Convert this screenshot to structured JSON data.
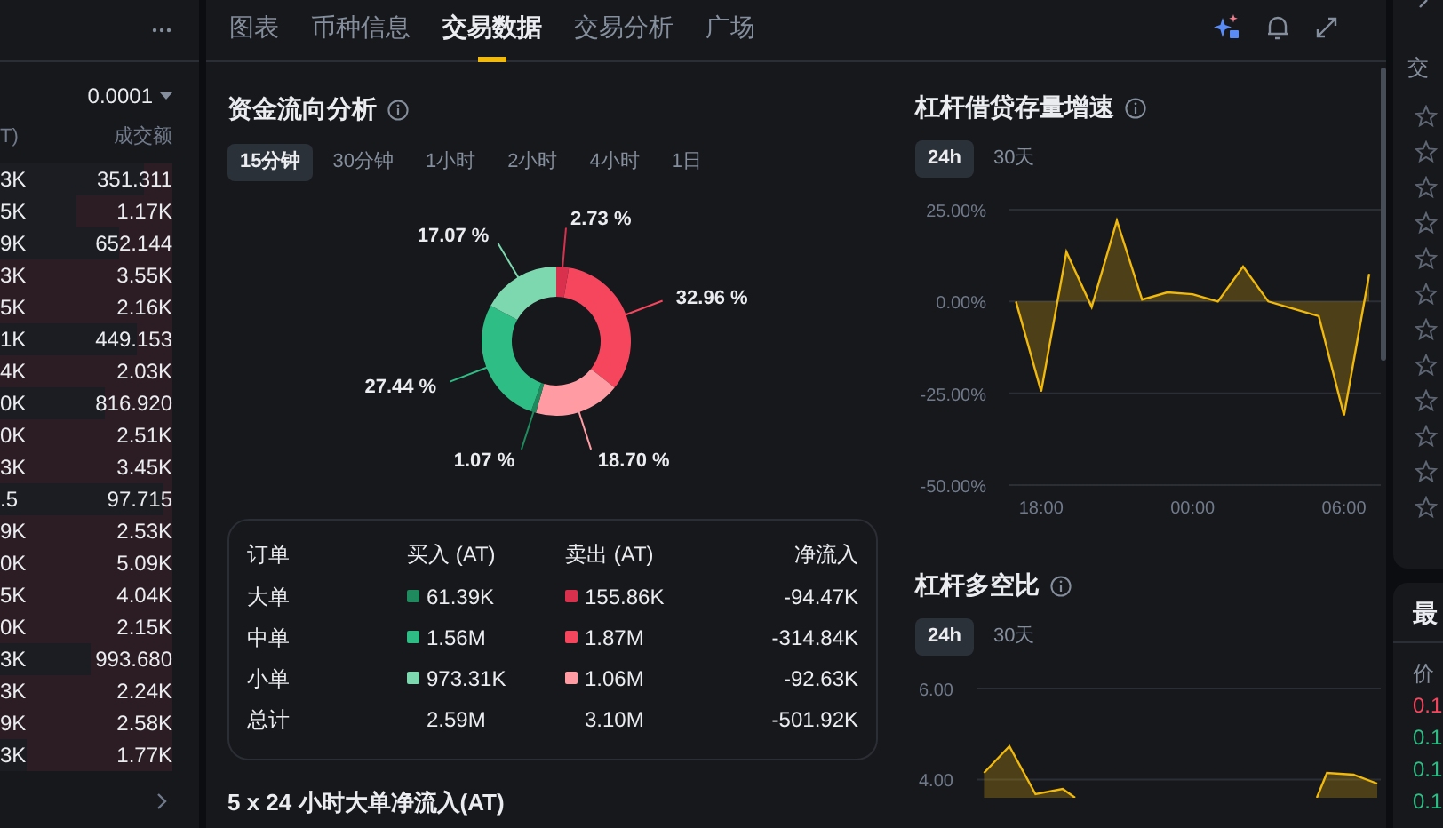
{
  "order_book": {
    "precision": "0.0001",
    "columns": [
      "T)",
      "成交额"
    ],
    "rows": [
      {
        "col1": "3K",
        "amount": "351.311",
        "level": 0.16
      },
      {
        "col1": "5K",
        "amount": "1.17K",
        "level": 0.56
      },
      {
        "col1": "9K",
        "amount": "652.144",
        "level": 0.31
      },
      {
        "col1": "3K",
        "amount": "3.55K",
        "level": 1
      },
      {
        "col1": "5K",
        "amount": "2.16K",
        "level": 1
      },
      {
        "col1": "1K",
        "amount": "449.153",
        "level": 0.21
      },
      {
        "col1": "4K",
        "amount": "2.03K",
        "level": 1
      },
      {
        "col1": "0K",
        "amount": "816.920",
        "level": 0.39
      },
      {
        "col1": "0K",
        "amount": "2.51K",
        "level": 1
      },
      {
        "col1": "3K",
        "amount": "3.45K",
        "level": 1
      },
      {
        "col1": ".5",
        "amount": "97.715",
        "level": 0.05
      },
      {
        "col1": "9K",
        "amount": "2.53K",
        "level": 1
      },
      {
        "col1": "0K",
        "amount": "5.09K",
        "level": 1
      },
      {
        "col1": "5K",
        "amount": "4.04K",
        "level": 1
      },
      {
        "col1": "0K",
        "amount": "2.15K",
        "level": 1
      },
      {
        "col1": "3K",
        "amount": "993.680",
        "level": 0.47
      },
      {
        "col1": "3K",
        "amount": "2.24K",
        "level": 1
      },
      {
        "col1": "9K",
        "amount": "2.58K",
        "level": 1
      },
      {
        "col1": "3K",
        "amount": "1.77K",
        "level": 0.85
      }
    ]
  },
  "tabs": [
    {
      "label": "图表",
      "selected": false
    },
    {
      "label": "币种信息",
      "selected": false
    },
    {
      "label": "交易数据",
      "selected": true
    },
    {
      "label": "交易分析",
      "selected": false
    },
    {
      "label": "广场",
      "selected": false
    }
  ],
  "fund_flow": {
    "title": "资金流向分析",
    "intervals": [
      {
        "label": "15分钟",
        "selected": true
      },
      {
        "label": "30分钟",
        "selected": false
      },
      {
        "label": "1小时",
        "selected": false
      },
      {
        "label": "2小时",
        "selected": false
      },
      {
        "label": "4小时",
        "selected": false
      },
      {
        "label": "1日",
        "selected": false
      }
    ],
    "chart_data": {
      "type": "donut",
      "values": [
        2.73,
        32.96,
        18.7,
        1.07,
        27.44,
        17.07
      ],
      "colors": [
        "#d9304e",
        "#f6465d",
        "#ff9ca3",
        "#1e8a5e",
        "#2ebd85",
        "#7dd8b0"
      ],
      "value_labels": [
        "2.73 %",
        "32.96 %",
        "18.70 %",
        "1.07 %",
        "27.44 %",
        "17.07 %"
      ]
    },
    "table": {
      "columns": [
        "订单",
        "买入 (AT)",
        "卖出 (AT)",
        "净流入"
      ],
      "rows": [
        {
          "label": "大单",
          "buy": {
            "text": "61.39K",
            "color": "#1e8a5e"
          },
          "sell": {
            "text": "155.86K",
            "color": "#d9304e"
          },
          "net": "-94.47K"
        },
        {
          "label": "中单",
          "buy": {
            "text": "1.56M",
            "color": "#2ebd85"
          },
          "sell": {
            "text": "1.87M",
            "color": "#f6465d"
          },
          "net": "-314.84K"
        },
        {
          "label": "小单",
          "buy": {
            "text": "973.31K",
            "color": "#7dd8b0"
          },
          "sell": {
            "text": "1.06M",
            "color": "#ff9ca3"
          },
          "net": "-92.63K"
        },
        {
          "label": "总计",
          "buy": {
            "text": "2.59M"
          },
          "sell": {
            "text": "3.10M"
          },
          "net": "-501.92K"
        }
      ]
    }
  },
  "big_order_title": "5 x 24 小时大单净流入(AT)",
  "margin_growth": {
    "title": "杠杆借贷存量增速",
    "ranges": [
      {
        "label": "24h",
        "selected": true
      },
      {
        "label": "30天",
        "selected": false
      }
    ],
    "chart_data": {
      "type": "area",
      "categories": [
        null,
        "18:00",
        null,
        null,
        null,
        null,
        null,
        "00:00",
        null,
        null,
        null,
        null,
        null,
        "06:00",
        null
      ],
      "series": [
        {
          "color": "#f0b90b",
          "values": [
            0,
            -24.5,
            13.5,
            -1.5,
            22,
            0.5,
            2.5,
            2,
            0,
            9.5,
            0,
            -2,
            -4,
            -31,
            7.5
          ]
        }
      ],
      "ylim": [
        -50,
        25
      ],
      "yticks": [
        {
          "value": 25,
          "label": "25.00%"
        },
        {
          "value": 0,
          "label": "0.00%"
        },
        {
          "value": -25,
          "label": "-25.00%"
        },
        {
          "value": -50,
          "label": "-50.00%"
        }
      ]
    }
  },
  "long_short": {
    "title": "杠杆多空比",
    "ranges": [
      {
        "label": "24h",
        "selected": true
      },
      {
        "label": "30天",
        "selected": false
      }
    ],
    "axis_labels": [
      "6.00",
      "4.00"
    ]
  },
  "side_panel": {
    "header": "交",
    "card_title": "最",
    "column": "价",
    "prices": [
      {
        "text": "0.1",
        "color": "#f6465d"
      },
      {
        "text": "0.1",
        "color": "#2ebd85"
      },
      {
        "text": "0.1",
        "color": "#2ebd85"
      },
      {
        "text": "0.1",
        "color": "#2ebd85"
      }
    ]
  }
}
